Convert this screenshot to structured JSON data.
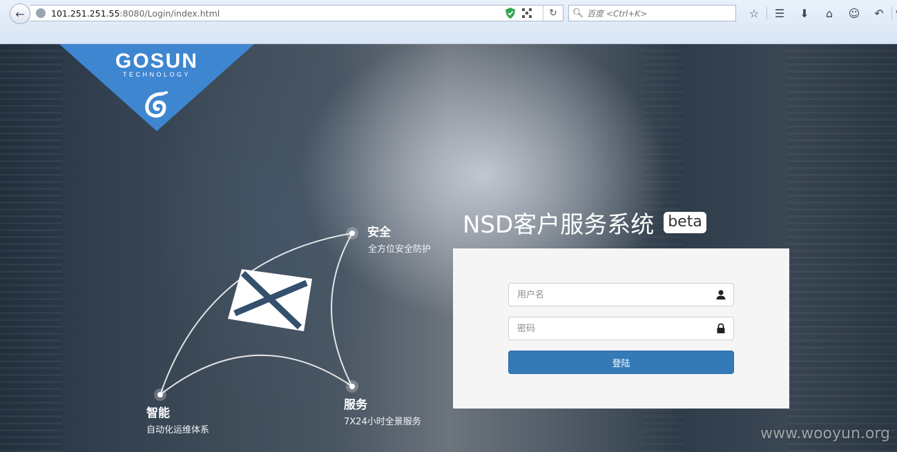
{
  "browser": {
    "url_host": "101.251.251.55",
    "url_rest": ":8080/Login/index.html",
    "search_placeholder": "百度 <Ctrl+K>"
  },
  "logo": {
    "name": "GOSUN",
    "tagline": "TECHNOLOGY",
    "brand_color": "#3f86d1"
  },
  "features": [
    {
      "title": "安全",
      "subtitle": "全方位安全防护"
    },
    {
      "title": "服务",
      "subtitle": "7X24小时全景服务"
    },
    {
      "title": "智能",
      "subtitle": "自动化运维体系"
    }
  ],
  "login": {
    "system_title": "NSD客户服务系统",
    "badge": "beta",
    "username_placeholder": "用户名",
    "password_placeholder": "密码",
    "submit_label": "登陆",
    "button_color": "#337ab7"
  },
  "watermark": "www.wooyun.org",
  "icons": {
    "back": "back-arrow-icon",
    "site": "globe-icon",
    "secure": "shield-icon",
    "qr": "qr-code-icon",
    "reload": "reload-icon",
    "search": "search-icon",
    "toolbar": [
      "star-icon",
      "reading-list-icon",
      "download-icon",
      "home-icon",
      "smiley-icon",
      "undo-icon",
      "menu-dropdown-icon"
    ],
    "user": "user-icon",
    "lock": "lock-icon",
    "mail": "envelope-icon"
  }
}
